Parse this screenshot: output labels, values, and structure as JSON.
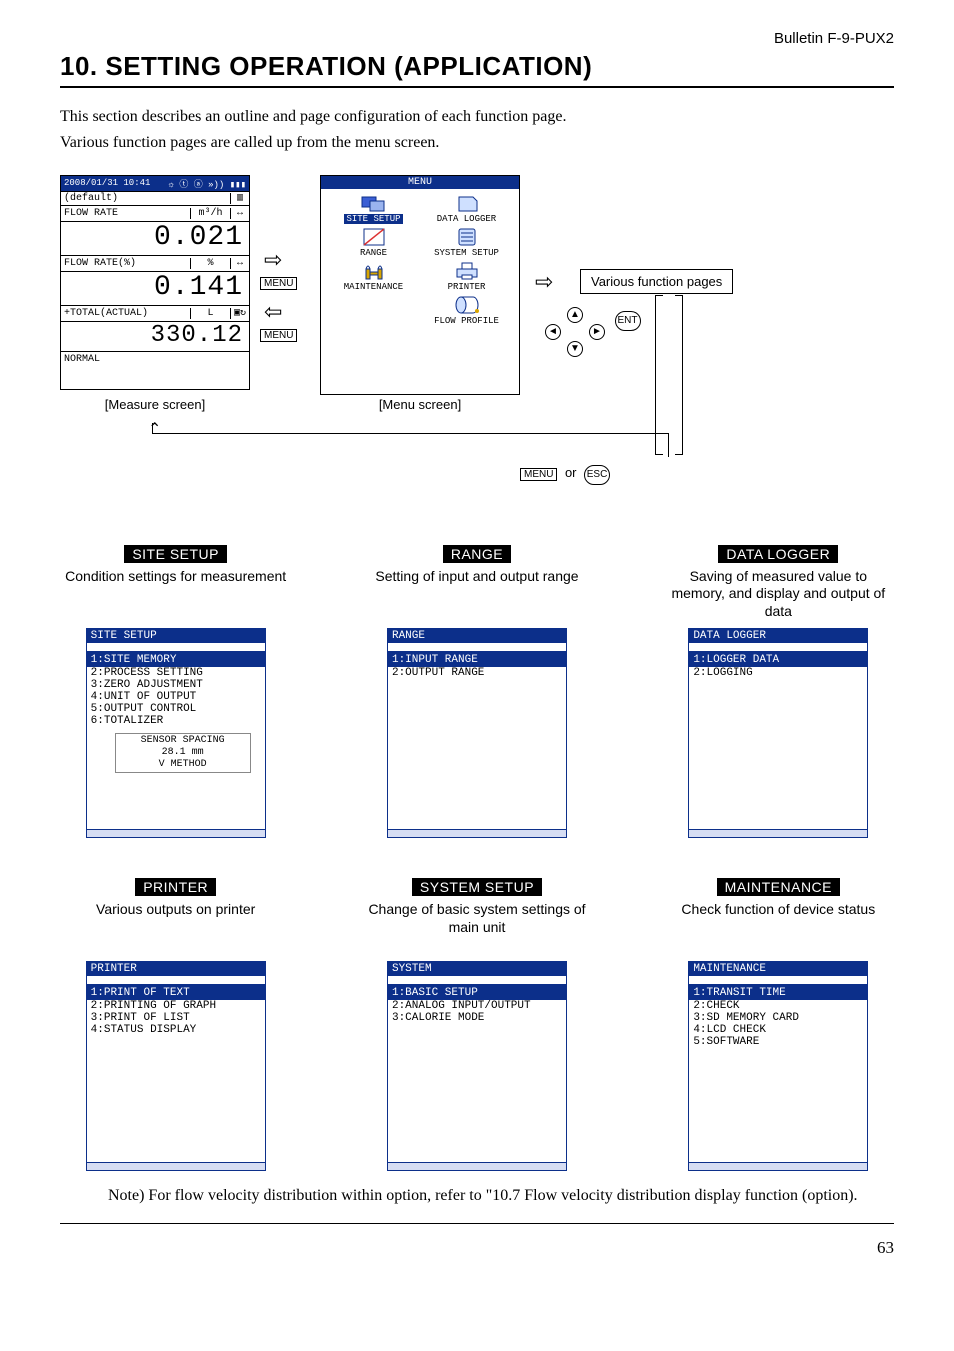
{
  "header": {
    "bulletin": "Bulletin F-9-PUX2",
    "title": "10. SETTING OPERATION (APPLICATION)"
  },
  "intro": {
    "p1": "This section describes an outline and page configuration of each function page.",
    "p2": "Various function pages are called up from the menu screen."
  },
  "measure": {
    "datetime": "2008/01/31 10:41",
    "default_label": "(default)",
    "row1_label": "FLOW RATE",
    "row1_unit": "m³/h",
    "row1_glyph": "↔",
    "val1": "0.021",
    "row2_label": "FLOW RATE(%)",
    "row2_unit": "%",
    "row2_glyph": "↔",
    "val2": "0.141",
    "row3_label": "+TOTAL(ACTUAL)",
    "row3_unit": "L",
    "row3_glyph": "▣↻",
    "val3": "330.12",
    "status": "NORMAL",
    "caption": "[Measure screen]"
  },
  "menu": {
    "title": "MENU",
    "items": {
      "site_setup": "SITE SETUP",
      "data_logger": "DATA LOGGER",
      "range": "RANGE",
      "system_setup": "SYSTEM SETUP",
      "maintenance": "MAINTENANCE",
      "printer": "PRINTER",
      "flow_profile": "FLOW PROFILE"
    },
    "caption": "[Menu screen]"
  },
  "keys": {
    "menu": "MENU",
    "ent": "ENT",
    "esc": "ESC",
    "or": "or"
  },
  "vfp_label": "Various function pages",
  "screens": {
    "site_setup": {
      "label": "SITE SETUP",
      "desc": "Condition settings for measurement",
      "hdr": "SITE SETUP",
      "sel": "1:SITE MEMORY",
      "items": [
        "2:PROCESS SETTING",
        "3:ZERO ADJUSTMENT",
        "4:UNIT OF OUTPUT",
        "5:OUTPUT CONTROL",
        "6:TOTALIZER"
      ],
      "sensor": {
        "l1": "SENSOR SPACING",
        "l2": "28.1 mm",
        "l3": "V METHOD"
      }
    },
    "range": {
      "label": "RANGE",
      "desc": "Setting of input and output range",
      "hdr": "RANGE",
      "sel": "1:INPUT RANGE",
      "items": [
        "2:OUTPUT RANGE"
      ]
    },
    "data_logger": {
      "label": "DATA LOGGER",
      "desc": "Saving of measured value to memory, and display and output of data",
      "hdr": "DATA LOGGER",
      "sel": "1:LOGGER DATA",
      "items": [
        "2:LOGGING"
      ]
    },
    "printer": {
      "label": "PRINTER",
      "desc": "Various outputs on printer",
      "hdr": "PRINTER",
      "sel": "1:PRINT OF TEXT",
      "items": [
        "2:PRINTING OF GRAPH",
        "3:PRINT OF LIST",
        "4:STATUS DISPLAY"
      ]
    },
    "system_setup": {
      "label": "SYSTEM SETUP",
      "desc": "Change of basic system settings of main unit",
      "hdr": "SYSTEM",
      "sel": "1:BASIC SETUP",
      "items": [
        "2:ANALOG INPUT/OUTPUT",
        "3:CALORIE MODE"
      ]
    },
    "maintenance": {
      "label": "MAINTENANCE",
      "desc": "Check function of device status",
      "hdr": "MAINTENANCE",
      "sel": "1:TRANSIT TIME",
      "items": [
        "2:CHECK",
        "3:SD MEMORY CARD",
        "4:LCD CHECK",
        "5:SOFTWARE"
      ]
    }
  },
  "note": "Note) For flow velocity distribution within option, refer to \"10.7 Flow velocity distribution display function (option).",
  "page_number": "63"
}
